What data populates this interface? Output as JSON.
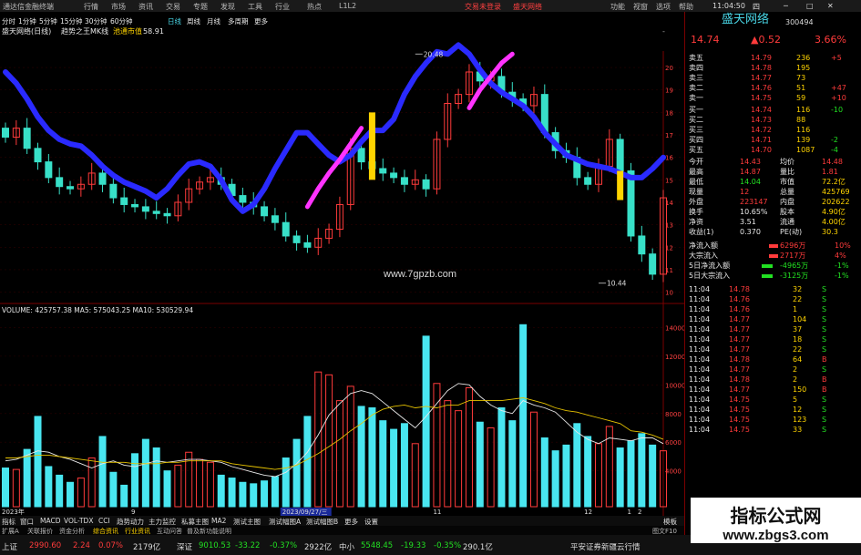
{
  "window": {
    "title": "通达信金融终端",
    "menus": [
      "行情",
      "市场",
      "资讯",
      "交易",
      "专题",
      "发现",
      "工具",
      "行业",
      "热点",
      "L1L2"
    ],
    "alerts": [
      "交易未登录",
      "盛天网络"
    ],
    "right_menus": [
      "功能",
      "视窗",
      "选项",
      "帮助"
    ],
    "time": "11:04:50",
    "time_suffix": "四"
  },
  "periods": [
    "分时",
    "1分钟",
    "5分钟",
    "15分钟",
    "30分钟",
    "60分钟",
    "日线",
    "周线",
    "月线",
    "多周期",
    "更多"
  ],
  "active_period": "日线",
  "main_chart": {
    "stock_label": "盛天网络(日线)",
    "indicator_name": "趋势之王MK线",
    "indicator_tag": "池通市值",
    "indicator_value": "58.91",
    "corner_label": "-",
    "high_marker": "20.48",
    "low_marker": "10.44",
    "watermark": "www.7gpzb.com"
  },
  "volume_chart": {
    "label": "VOLUME: 425757.38  MA5: 575043.25  MA10: 530529.94"
  },
  "chart_data": [
    {
      "type": "line",
      "title": "",
      "ylabel": "",
      "y_ticks": [
        10.0,
        11.0,
        12.0,
        13.0,
        14.0,
        15.0,
        16.0,
        17.0,
        18.0,
        19.0,
        20.0
      ],
      "ylim": [
        9.7,
        21.3
      ],
      "series": [
        {
          "values": [
            19.8,
            19.3,
            18.6,
            17.8,
            17.2,
            16.8,
            16.6,
            16.5,
            16.1,
            15.6,
            15.2,
            14.9,
            14.7,
            14.5,
            14.2,
            14.6,
            15.2,
            15.7,
            15.8,
            15.6,
            15.0,
            14.1,
            13.6,
            13.9,
            14.6,
            15.5,
            16.3,
            17.1,
            17.1,
            16.6,
            16.1,
            15.8,
            16.1,
            16.7,
            17.2,
            17.2,
            17.7,
            18.8,
            19.6,
            20.2,
            20.7,
            20.6,
            21.0,
            20.6,
            19.9,
            19.3,
            18.9,
            18.6,
            18.3,
            17.8,
            17.1,
            16.6,
            16.1,
            15.9,
            15.7,
            15.6,
            15.5,
            15.3,
            15.1,
            15.1,
            15.5,
            16.0
          ]
        },
        {
          "values": [
            null,
            null,
            null,
            null,
            null,
            null,
            null,
            null,
            null,
            null,
            null,
            null,
            null,
            null,
            null,
            null,
            null,
            null,
            null,
            null,
            null,
            null,
            null,
            null,
            null,
            null,
            null,
            null,
            13.8,
            14.6,
            15.3,
            15.9,
            16.6,
            17.3,
            null,
            null,
            null,
            null,
            null,
            null,
            null,
            null,
            null,
            null,
            null,
            null,
            null,
            null,
            null,
            null,
            null,
            null,
            null,
            null,
            null,
            null,
            null,
            null,
            null,
            null,
            null,
            null
          ]
        },
        {
          "values": [
            null,
            null,
            null,
            null,
            null,
            null,
            null,
            null,
            null,
            null,
            null,
            null,
            null,
            null,
            null,
            null,
            null,
            null,
            null,
            null,
            null,
            null,
            null,
            null,
            null,
            null,
            null,
            null,
            null,
            null,
            null,
            null,
            null,
            null,
            null,
            null,
            null,
            null,
            null,
            null,
            null,
            null,
            null,
            18.2,
            19.0,
            19.6,
            20.2,
            20.6,
            null,
            null,
            null,
            null,
            null,
            null,
            null,
            null,
            null,
            null,
            null,
            null,
            null,
            null
          ]
        },
        {
          "values": [
            16.9,
            17.3,
            16.4,
            15.8,
            15.1,
            14.7,
            14.6,
            14.8,
            15.3,
            14.8,
            14.2,
            13.9,
            13.8,
            13.6,
            13.5,
            13.4,
            14.0,
            14.6,
            14.9,
            15.1,
            14.8,
            14.3,
            14.0,
            13.8,
            13.4,
            13.1,
            12.5,
            12.2,
            12.0,
            12.4,
            12.8,
            13.9,
            16.4,
            15.8,
            15.5,
            15.3,
            15.1,
            14.8,
            15.0,
            14.6,
            16.8,
            18.4,
            18.8,
            19.8,
            19.4,
            19.6,
            18.9,
            18.6,
            18.3,
            18.8,
            17.1,
            16.3,
            16.0,
            15.1,
            14.8,
            15.6,
            16.8,
            15.4,
            12.5,
            11.7,
            10.8,
            14.2
          ]
        }
      ]
    },
    {
      "type": "bar",
      "title": "",
      "y_ticks": [
        4000,
        6000,
        8000,
        10000,
        12000,
        14000
      ],
      "ylim": [
        1500,
        14600
      ],
      "series": [
        {
          "name": "VOLUME",
          "values": [
            4200,
            4100,
            5500,
            7800,
            4300,
            3700,
            3200,
            3500,
            4900,
            6400,
            3900,
            3000,
            5200,
            6200,
            5600,
            4000,
            4400,
            5300,
            4800,
            4600,
            3700,
            3500,
            3200,
            3100,
            3300,
            3600,
            4900,
            6200,
            7800,
            10900,
            10700,
            8900,
            9900,
            8500,
            8400,
            7500,
            6900,
            7300,
            5900,
            13400,
            10100,
            8900,
            8200,
            9800,
            7400,
            7000,
            8400,
            7500,
            14200,
            8100,
            6300,
            5400,
            5800,
            7300,
            6400,
            5900,
            7100,
            5600,
            6100,
            6600,
            5800,
            5400
          ]
        },
        {
          "name": "MA5",
          "values": [
            4700,
            4800,
            5100,
            5400,
            5300,
            5000,
            4800,
            4500,
            4200,
            4500,
            4700,
            4400,
            4300,
            4500,
            4700,
            4600,
            4700,
            4800,
            4800,
            4700,
            4600,
            4300,
            4100,
            3900,
            3700,
            3600,
            3900,
            4500,
            5300,
            6500,
            7900,
            8700,
            9400,
            9600,
            9400,
            8800,
            8200,
            7600,
            7000,
            7800,
            8700,
            9600,
            10100,
            10000,
            9200,
            8600,
            8200,
            8000,
            8900,
            8600,
            8400,
            8100,
            7400,
            6700,
            6200,
            5900,
            6300,
            6200,
            6100,
            6300,
            6300,
            5900
          ]
        },
        {
          "name": "MA10",
          "values": [
            4900,
            4900,
            5000,
            5100,
            5100,
            5000,
            4900,
            4800,
            4700,
            4600,
            4600,
            4600,
            4500,
            4500,
            4500,
            4600,
            4600,
            4700,
            4700,
            4700,
            4700,
            4500,
            4400,
            4300,
            4200,
            4100,
            4200,
            4400,
            4800,
            5200,
            5700,
            6200,
            6800,
            7300,
            7900,
            8300,
            8500,
            8600,
            8400,
            8500,
            8400,
            8600,
            8600,
            8900,
            8900,
            8900,
            8900,
            9000,
            9100,
            8900,
            8700,
            8400,
            8200,
            8100,
            7900,
            7700,
            7500,
            7300,
            6800,
            6700,
            6500,
            6200
          ]
        }
      ]
    }
  ],
  "quote": {
    "name": "盛天网络",
    "code": "300494",
    "price": "14.74",
    "change": "▲0.52",
    "change_pct": "3.66%",
    "asks": [
      {
        "label": "卖五",
        "price": "14.79",
        "vol": "236",
        "chg": "+5"
      },
      {
        "label": "卖四",
        "price": "14.78",
        "vol": "195",
        "chg": ""
      },
      {
        "label": "卖三",
        "price": "14.77",
        "vol": "73",
        "chg": ""
      },
      {
        "label": "卖二",
        "price": "14.76",
        "vol": "51",
        "chg": "+47"
      },
      {
        "label": "卖一",
        "price": "14.75",
        "vol": "59",
        "chg": "+10"
      }
    ],
    "bids": [
      {
        "label": "买一",
        "price": "14.74",
        "vol": "116",
        "chg": "-10"
      },
      {
        "label": "买二",
        "price": "14.73",
        "vol": "88",
        "chg": ""
      },
      {
        "label": "买三",
        "price": "14.72",
        "vol": "116",
        "chg": ""
      },
      {
        "label": "买四",
        "price": "14.71",
        "vol": "139",
        "chg": "-2"
      },
      {
        "label": "买五",
        "price": "14.70",
        "vol": "1087",
        "chg": "-4"
      }
    ],
    "stats": [
      {
        "k1": "今开",
        "v1": "14.43",
        "k2": "均价",
        "v2": "14.48"
      },
      {
        "k1": "最高",
        "v1": "14.87",
        "k2": "量比",
        "v2": "1.81"
      },
      {
        "k1": "最低",
        "v1": "14.04",
        "k2": "市值",
        "v2": "72.2亿"
      },
      {
        "k1": "现量",
        "v1": "12",
        "k2": "总量",
        "v2": "425769"
      },
      {
        "k1": "外盘",
        "v1": "223147",
        "k2": "内盘",
        "v2": "202622"
      },
      {
        "k1": "换手",
        "v1": "10.65%",
        "k2": "股本",
        "v2": "4.90亿"
      },
      {
        "k1": "净资",
        "v1": "3.51",
        "k2": "流通",
        "v2": "4.00亿"
      },
      {
        "k1": "收益(1)",
        "v1": "0.370",
        "k2": "PE(动)",
        "v2": "30.3"
      }
    ],
    "flows": [
      {
        "label": "净流入额",
        "value": "6296万",
        "pct": "10%"
      },
      {
        "label": "大宗流入",
        "value": "2717万",
        "pct": "4%"
      },
      {
        "label": "5日净流入额",
        "value": "-4965万",
        "pct": "-1%"
      },
      {
        "label": "5日大宗流入",
        "value": "-3125万",
        "pct": "-1%"
      }
    ],
    "ticks": [
      {
        "t": "11:04",
        "p": "14.78",
        "v": "32",
        "d": "S"
      },
      {
        "t": "11:04",
        "p": "14.76",
        "v": "22",
        "d": "S"
      },
      {
        "t": "11:04",
        "p": "14.76",
        "v": "1",
        "d": "S"
      },
      {
        "t": "11:04",
        "p": "14.77",
        "v": "104",
        "d": "S"
      },
      {
        "t": "11:04",
        "p": "14.77",
        "v": "37",
        "d": "S"
      },
      {
        "t": "11:04",
        "p": "14.77",
        "v": "18",
        "d": "S"
      },
      {
        "t": "11:04",
        "p": "14.77",
        "v": "22",
        "d": "S"
      },
      {
        "t": "11:04",
        "p": "14.78",
        "v": "64",
        "d": "B"
      },
      {
        "t": "11:04",
        "p": "14.77",
        "v": "2",
        "d": "S"
      },
      {
        "t": "11:04",
        "p": "14.78",
        "v": "2",
        "d": "B"
      },
      {
        "t": "11:04",
        "p": "14.77",
        "v": "150",
        "d": "B"
      },
      {
        "t": "11:04",
        "p": "14.75",
        "v": "5",
        "d": "S"
      },
      {
        "t": "11:04",
        "p": "14.75",
        "v": "12",
        "d": "S"
      },
      {
        "t": "11:04",
        "p": "14.75",
        "v": "123",
        "d": "S"
      },
      {
        "t": "11:04",
        "p": "14.75",
        "v": "33",
        "d": "S"
      }
    ]
  },
  "volume_ticks": [
    "14000",
    "12000",
    "10000",
    "8000",
    "6000",
    "4000"
  ],
  "x_labels": [
    "2023年",
    "9",
    "2023/09/27/三",
    "11",
    "12",
    "1",
    "2"
  ],
  "bottom_tabs": [
    "指标",
    "窗口",
    "MACD",
    "VOL-TDX",
    "CCI",
    "趋势动力",
    "主力监控",
    "私募主图",
    "MA2",
    "测试主图",
    "测试幅图A",
    "测试幅图B",
    "更多",
    "设置"
  ],
  "bottom_right": "模板",
  "extension_bar": [
    "扩展A",
    "关联报价",
    "资金分析",
    "综合资讯",
    "行业资讯",
    "互动问答",
    "普及新功能说明"
  ],
  "extension_right": "图文F10",
  "index_bar": [
    {
      "name": "上证",
      "value": "2990.60",
      "change": "2.24",
      "pct": "0.07%",
      "amount": "2179亿"
    },
    {
      "name": "深证",
      "value": "9010.53",
      "change": "-33.22",
      "pct": "-0.37%",
      "amount": "2922亿"
    },
    {
      "name": "中小",
      "value": "5548.45",
      "change": "-19.33",
      "pct": "-0.35%",
      "amount": "290.1亿"
    }
  ],
  "broker_label": "平安证券新疆云行情",
  "watermark_site": {
    "title": "指标公式网",
    "url": "www.zbgs3.com"
  }
}
